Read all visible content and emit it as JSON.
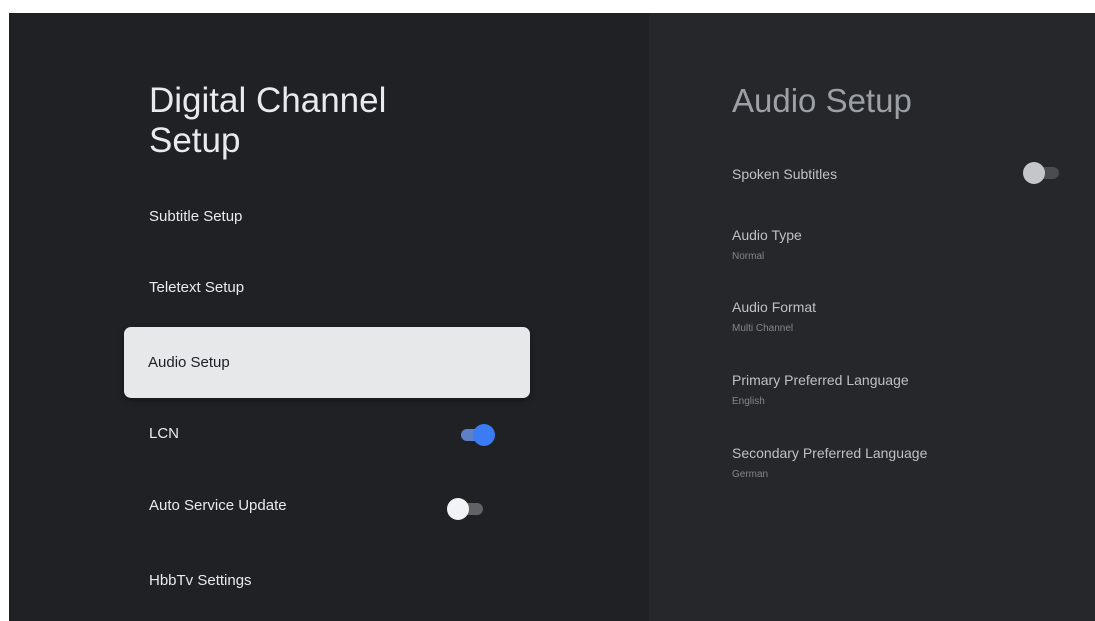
{
  "left_panel": {
    "title": "Digital Channel\nSetup",
    "items": [
      {
        "label": "Subtitle Setup"
      },
      {
        "label": "Teletext Setup"
      },
      {
        "label": "Audio Setup"
      },
      {
        "label": "LCN",
        "toggle": "on"
      },
      {
        "label": "Auto Service Update",
        "toggle": "off"
      },
      {
        "label": "HbbTv Settings"
      }
    ],
    "selected_index": 2
  },
  "right_panel": {
    "title": "Audio Setup",
    "spoken_subtitles": {
      "label": "Spoken Subtitles",
      "toggle": "off"
    },
    "settings": [
      {
        "label": "Audio Type",
        "value": "Normal"
      },
      {
        "label": "Audio Format",
        "value": "Multi Channel"
      },
      {
        "label": "Primary Preferred Language",
        "value": "English"
      },
      {
        "label": "Secondary Preferred Language",
        "value": "German"
      }
    ]
  },
  "colors": {
    "background": "#202124",
    "selected_item_background": "#e6e8e9",
    "toggle_on": "#3b7cf4"
  }
}
